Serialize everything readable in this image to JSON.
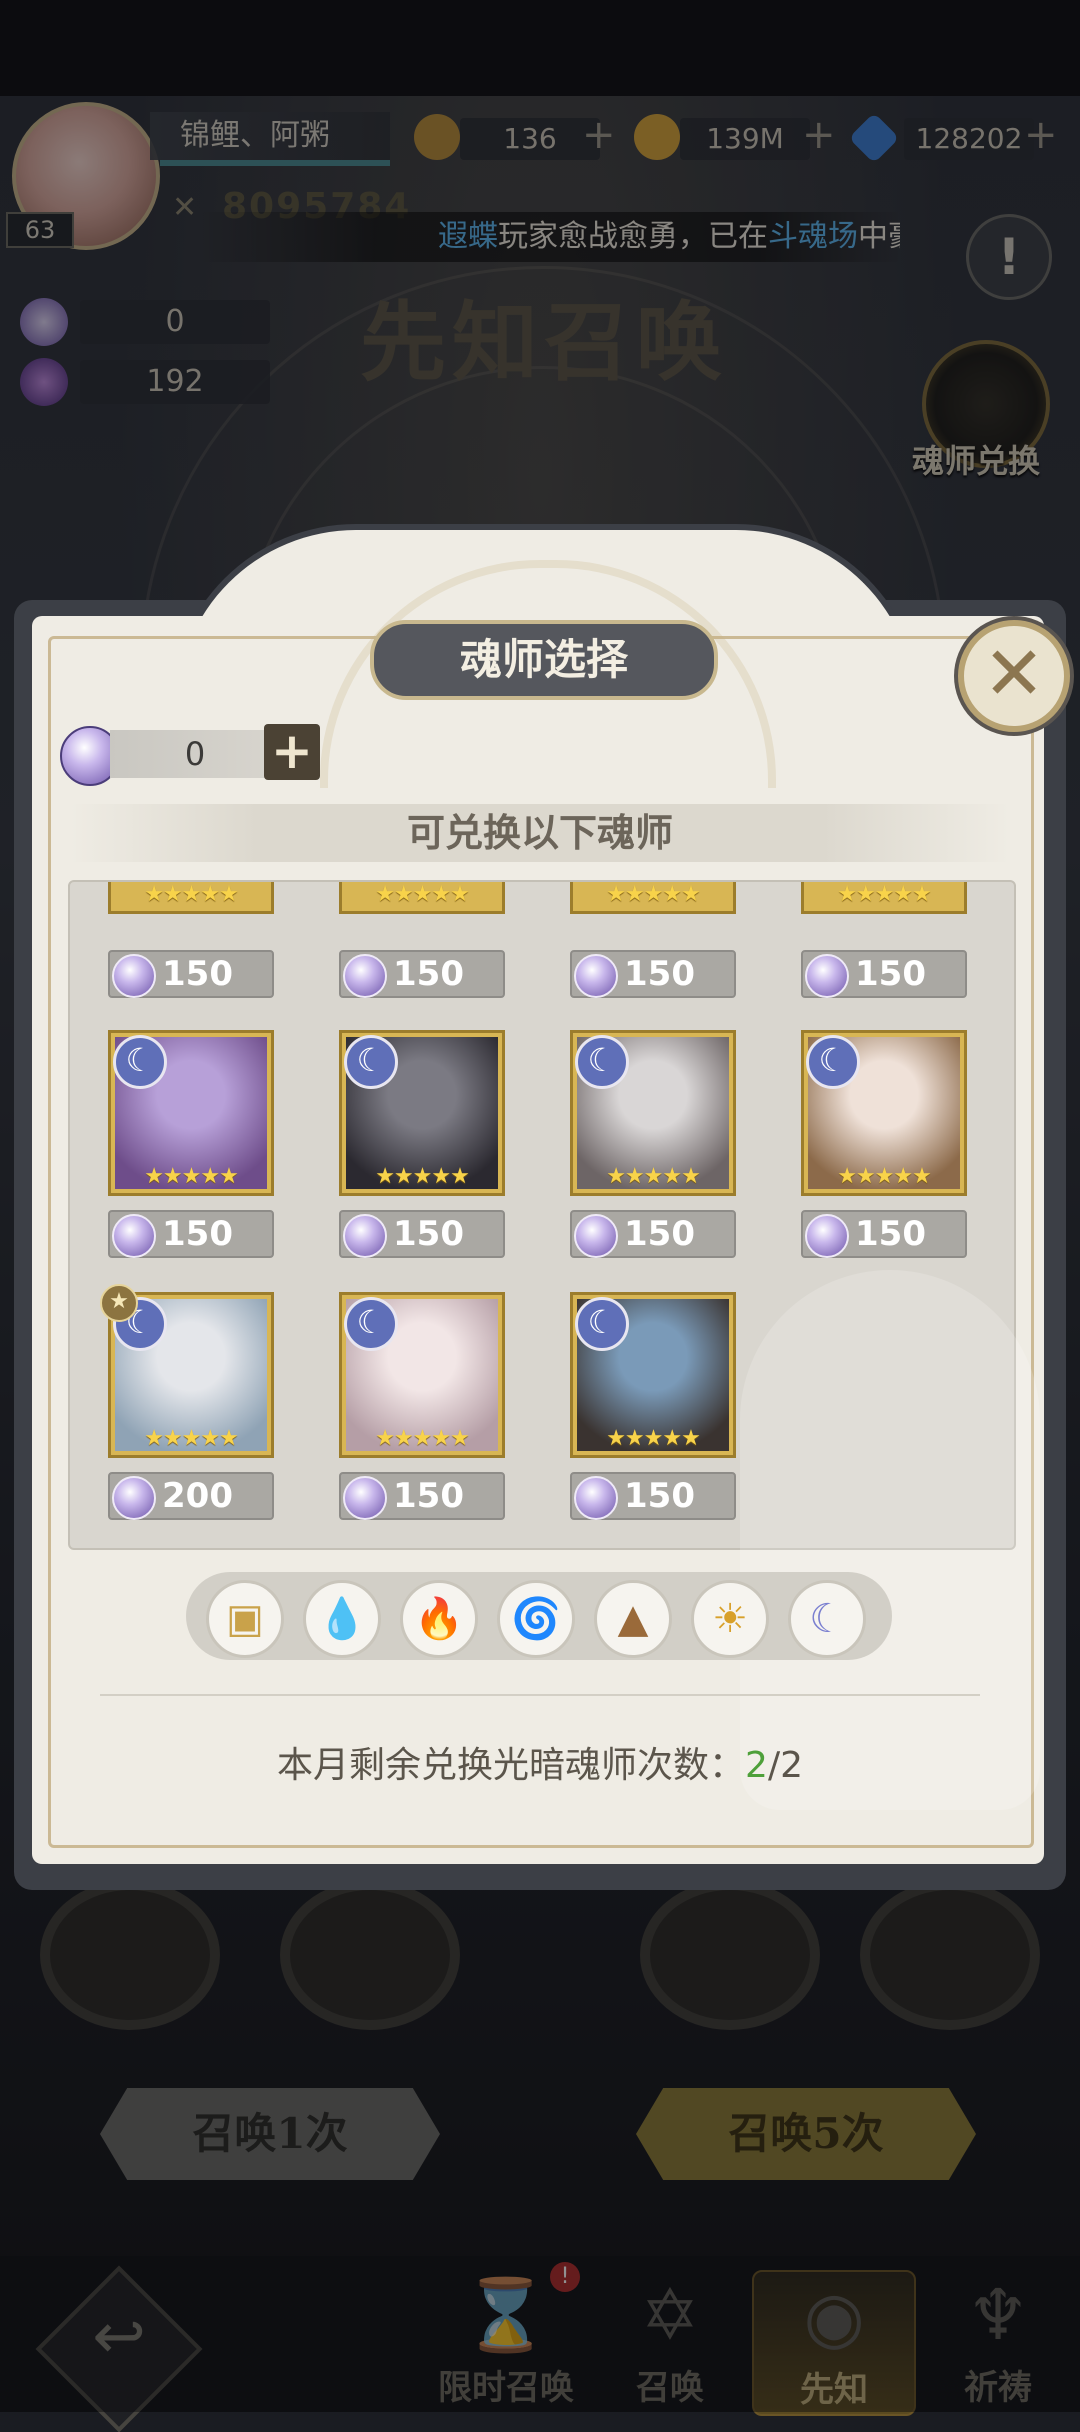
{
  "top": {
    "player_name": "锦鲤、阿粥",
    "level": "63",
    "power": "8095784",
    "resources": [
      {
        "value": "136",
        "icon": "copper-coin-icon",
        "color": "#b98c3a"
      },
      {
        "value": "139M",
        "icon": "gold-coin-icon",
        "color": "#d7a53a"
      },
      {
        "value": "128202",
        "icon": "diamond-icon",
        "color": "#3b7fd6"
      }
    ],
    "marquee": {
      "name": "遐蝶",
      "middle": "玩家愈战愈勇，已在",
      "place": "斗魂场",
      "tail": "中豪"
    },
    "info_icon": "!",
    "stats": [
      "0",
      "192"
    ],
    "bg_title": "先知召唤",
    "exchange_label": "魂师兑换"
  },
  "modal": {
    "title": "魂师选择",
    "close": "✕",
    "currency_value": "0",
    "plus": "+",
    "subheader": "可兑换以下魂师",
    "cards_partial": [
      {
        "stars": "★★★★★",
        "cost": "150"
      },
      {
        "stars": "★★★★★",
        "cost": "150"
      },
      {
        "stars": "★★★★★",
        "cost": "150"
      },
      {
        "stars": "★★★★★",
        "cost": "150"
      }
    ],
    "cards": [
      {
        "stars": "★★★★★",
        "cost": "150",
        "badge": "☾",
        "colors": [
          "#b7a0d8",
          "#6e4d8a"
        ]
      },
      {
        "stars": "★★★★★",
        "cost": "150",
        "badge": "☾",
        "colors": [
          "#7b7a83",
          "#2b2930"
        ]
      },
      {
        "stars": "★★★★★",
        "cost": "150",
        "badge": "☾",
        "colors": [
          "#d9d6d6",
          "#6d6566"
        ]
      },
      {
        "stars": "★★★★★",
        "cost": "150",
        "badge": "☾",
        "colors": [
          "#efe1d8",
          "#8c6a4a"
        ]
      },
      {
        "stars": "★★★★★",
        "cost": "200",
        "badge": "☾",
        "rank": "★",
        "colors": [
          "#e4e6ea",
          "#8fa3b5"
        ]
      },
      {
        "stars": "★★★★★",
        "cost": "150",
        "badge": "☾",
        "colors": [
          "#f2e6e6",
          "#b59ea6"
        ]
      },
      {
        "stars": "★★★★★",
        "cost": "150",
        "badge": "☾",
        "colors": [
          "#7a9ab8",
          "#3a3330"
        ]
      }
    ],
    "filters": [
      {
        "icon": "box-icon",
        "glyph": "▣",
        "color": "#c9a24a"
      },
      {
        "icon": "water-drop-icon",
        "glyph": "💧",
        "color": "#3a8fd6"
      },
      {
        "icon": "fire-icon",
        "glyph": "🔥",
        "color": "#d84a3a"
      },
      {
        "icon": "wind-icon",
        "glyph": "🌀",
        "color": "#3aa66a"
      },
      {
        "icon": "mountain-icon",
        "glyph": "▲",
        "color": "#9a6a3a"
      },
      {
        "icon": "sun-icon",
        "glyph": "☀",
        "color": "#d8a02a"
      },
      {
        "icon": "moon-icon",
        "glyph": "☾",
        "color": "#7a7fd0"
      }
    ],
    "remaining_label": "本月剩余兑换光暗魂师次数：",
    "remaining_used": "2",
    "remaining_total": "/2"
  },
  "bottom": {
    "summon_once": "召唤1次",
    "summon_five": "召唤5次",
    "nav": [
      {
        "label": "限时召唤",
        "icon": "hourglass-icon",
        "glyph": "⌛"
      },
      {
        "label": "召唤",
        "icon": "star-icon",
        "glyph": "✡"
      },
      {
        "label": "先知",
        "icon": "prophet-icon",
        "glyph": "◉"
      },
      {
        "label": "祈祷",
        "icon": "prayer-icon",
        "glyph": "♆"
      }
    ],
    "badge": "!",
    "back": "↩"
  }
}
